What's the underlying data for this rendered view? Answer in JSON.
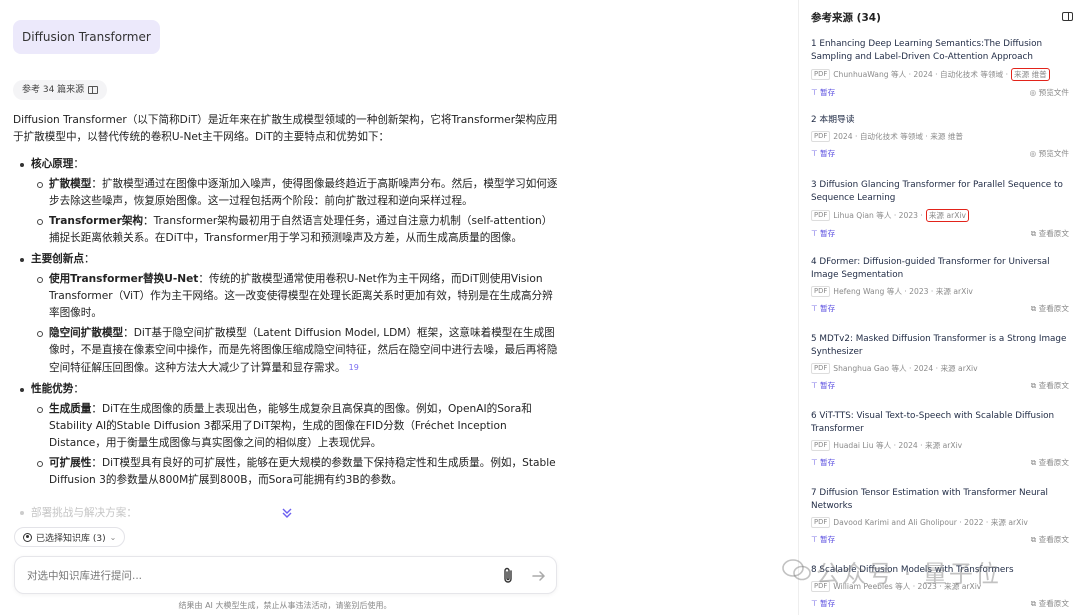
{
  "chat": {
    "user_message": "Diffusion Transformer",
    "ref_label": "参考 34 篇来源",
    "answer": {
      "intro": "Diffusion Transformer（以下简称DiT）是近年来在扩散生成模型领域的一种创新架构，它将Transformer架构应用于扩散模型中，以替代传统的卷积U-Net主干网络。DiT的主要特点和优势如下：",
      "sections": [
        {
          "title": "核心原理",
          "items": [
            {
              "label": "扩散模型",
              "text": "扩散模型通过在图像中逐渐加入噪声，使得图像最终趋近于高斯噪声分布。然后，模型学习如何逐步去除这些噪声，恢复原始图像。这一过程包括两个阶段：前向扩散过程和逆向采样过程。"
            },
            {
              "label": "Transformer架构",
              "text": "Transformer架构最初用于自然语言处理任务，通过自注意力机制（self-attention）捕捉长距离依赖关系。在DiT中，Transformer用于学习和预测噪声及方差，从而生成高质量的图像。"
            }
          ]
        },
        {
          "title": "主要创新点",
          "items": [
            {
              "label": "使用Transformer替换U-Net",
              "text": "传统的扩散模型通常使用卷积U-Net作为主干网络，而DiT则使用Vision Transformer（ViT）作为主干网络。这一改变使得模型在处理长距离关系时更加有效，特别是在生成高分辨率图像时。"
            },
            {
              "label": "隐空间扩散模型",
              "text": "DiT基于隐空间扩散模型（Latent Diffusion Model, LDM）框架，这意味着模型在生成图像时，不是直接在像素空间中操作，而是先将图像压缩成隐空间特征，然后在隐空间中进行去噪，最后再将隐空间特征解压回图像。这种方法大大减少了计算量和显存需求。",
              "cite": "19"
            }
          ]
        },
        {
          "title": "性能优势",
          "items": [
            {
              "label": "生成质量",
              "text": "DiT在生成图像的质量上表现出色，能够生成复杂且高保真的图像。例如，OpenAI的Sora和Stability AI的Stable Diffusion 3都采用了DiT架构，生成的图像在FID分数（Fréchet Inception Distance，用于衡量生成图像与真实图像之间的相似度）上表现优异。"
            },
            {
              "label": "可扩展性",
              "text": "DiT模型具有良好的可扩展性，能够在更大规模的参数量下保持稳定性和生成质量。例如，Stable Diffusion 3的参数量从800M扩展到800B，而Sora可能拥有约3B的参数。"
            }
          ]
        }
      ],
      "faded_next": "部署挑战与解决方案"
    },
    "kb_selector": "已选择知识库 (3)",
    "input_placeholder": "对选中知识库进行提问...",
    "disclaimer": "结果由 AI 大模型生成，禁止从事违法活动，请鉴别后使用。"
  },
  "sources": {
    "title": "参考来源 (34)",
    "save_label": "暂存",
    "items": [
      {
        "num": "1",
        "title": "Enhancing Deep Learning Semantics:The Diffusion Sampling and Label-Driven Co-Attention Approach",
        "meta": "ChunhuaWang 等人 · 2024 · 自动化技术 等领域 ·",
        "source": "来源 维普",
        "highlight": true,
        "action": "预览文件"
      },
      {
        "num": "2",
        "title": "本期导读",
        "meta": "2024 · 自动化技术 等领域 · 来源 维普",
        "source": "",
        "highlight": false,
        "action": "预览文件"
      },
      {
        "num": "3",
        "title": "Diffusion Glancing Transformer for Parallel Sequence to Sequence Learning",
        "meta": "Lihua Qian 等人 · 2023 ·",
        "source": "来源 arXiv",
        "highlight": true,
        "action": "查看原文"
      },
      {
        "num": "4",
        "title": "DFormer: Diffusion-guided Transformer for Universal Image Segmentation",
        "meta": "Hefeng Wang 等人 · 2023 · 来源 arXiv",
        "source": "",
        "highlight": false,
        "action": "查看原文"
      },
      {
        "num": "5",
        "title": "MDTv2: Masked Diffusion Transformer is a Strong Image Synthesizer",
        "meta": "Shanghua Gao 等人 · 2024 · 来源 arXiv",
        "source": "",
        "highlight": false,
        "action": "查看原文"
      },
      {
        "num": "6",
        "title": "ViT-TTS: Visual Text-to-Speech with Scalable Diffusion Transformer",
        "meta": "Huadai Liu 等人 · 2024 · 来源 arXiv",
        "source": "",
        "highlight": false,
        "action": "查看原文"
      },
      {
        "num": "7",
        "title": "Diffusion Tensor Estimation with Transformer Neural Networks",
        "meta": "Davood Karimi and Ali Gholipour · 2022 · 来源 arXiv",
        "source": "",
        "highlight": false,
        "action": "查看原文"
      },
      {
        "num": "8",
        "title": "Scalable Diffusion Models with Transformers",
        "meta": "William Peebles 等人 · 2023 · 来源 arXiv",
        "source": "",
        "highlight": false,
        "action": "查看原文"
      }
    ]
  },
  "watermark": "公众号 · 量子位",
  "colors": {
    "accent": "#5a4ee0",
    "bubble": "#ece9fb",
    "highlight": "#e2231a"
  }
}
